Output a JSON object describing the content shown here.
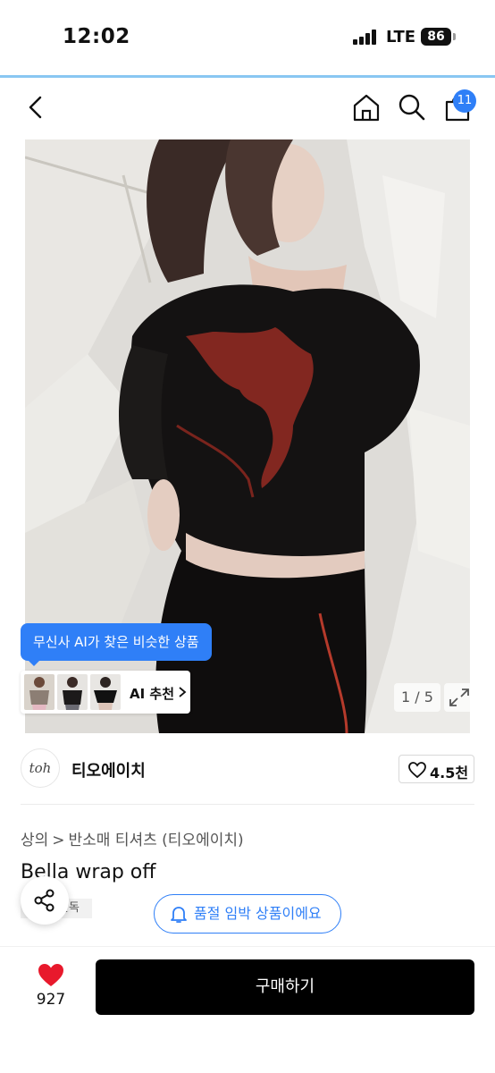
{
  "status_bar": {
    "time": "12:02",
    "network": "LTE",
    "battery": "86"
  },
  "nav": {
    "cart_badge": "11"
  },
  "gallery": {
    "ai_tooltip": "무신사 AI가 찾은 비슷한 상품",
    "ai_recommend_label": "AI 추천",
    "counter": "1 / 5"
  },
  "brand": {
    "logo_text": "toh",
    "name": "티오에이치",
    "likes": "4.5천"
  },
  "breadcrumb": {
    "category": "상의",
    "subcategory": "반소매 티셔츠 (티오에이치)",
    "separator": ">"
  },
  "product": {
    "title": "Bella wrap off",
    "tag": "단독"
  },
  "stock_notice": "품절 임박 상품이에요",
  "bottom": {
    "heart_count": "927",
    "buy_label": "구매하기"
  },
  "colors": {
    "accent": "#2f7ff7",
    "heart": "#e8192c",
    "buy_button": "#000000"
  },
  "icons": [
    "back-icon",
    "home-icon",
    "search-icon",
    "cart-icon",
    "expand-icon",
    "heart-icon",
    "share-icon",
    "bell-icon"
  ]
}
